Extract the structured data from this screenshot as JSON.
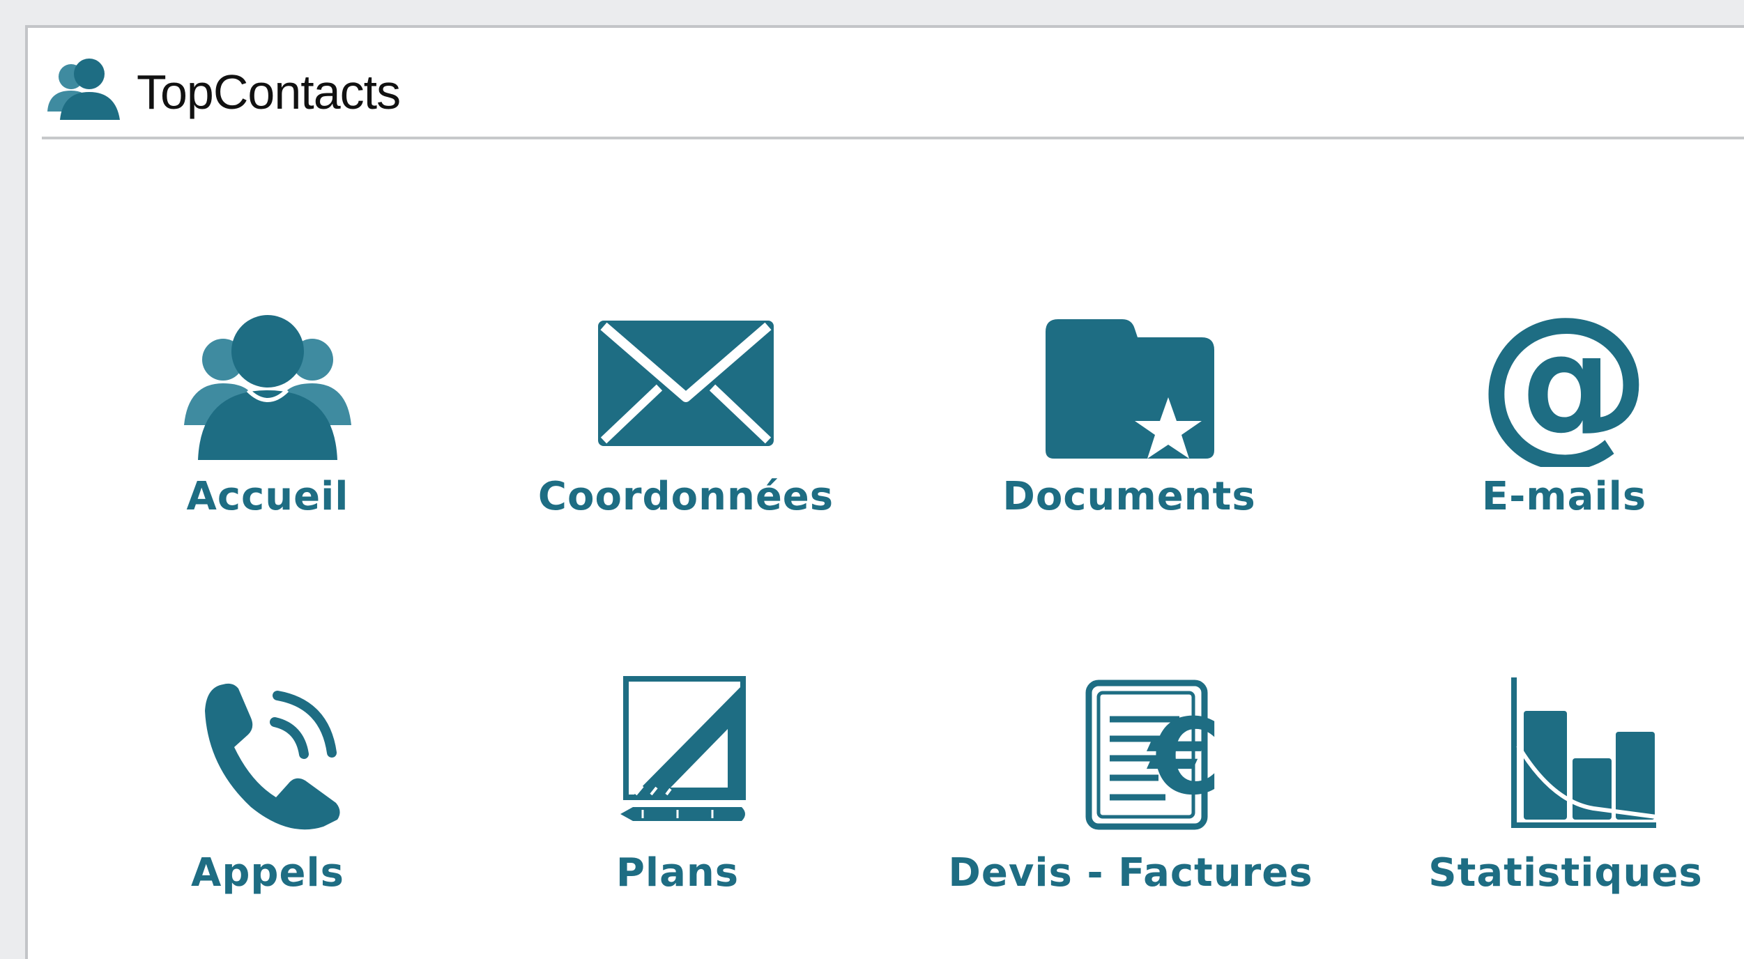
{
  "app": {
    "title": "TopContacts",
    "icon": "contacts-group-icon"
  },
  "theme": {
    "accent": "#1e6d83",
    "accent_light": "#3f8ba0",
    "title_color": "#111111"
  },
  "tiles": [
    {
      "label": "Accueil",
      "icon": "users-group-icon"
    },
    {
      "label": "Coordonnées",
      "icon": "envelope-icon"
    },
    {
      "label": "Documents",
      "icon": "folder-star-icon"
    },
    {
      "label": "E-mails",
      "icon": "at-sign-icon"
    },
    {
      "label": "Appels",
      "icon": "phone-icon"
    },
    {
      "label": "Plans",
      "icon": "set-square-pencil-icon"
    },
    {
      "label": "Devis - Factures",
      "icon": "invoice-euro-icon"
    },
    {
      "label": "Statistiques",
      "icon": "bar-chart-icon"
    }
  ]
}
